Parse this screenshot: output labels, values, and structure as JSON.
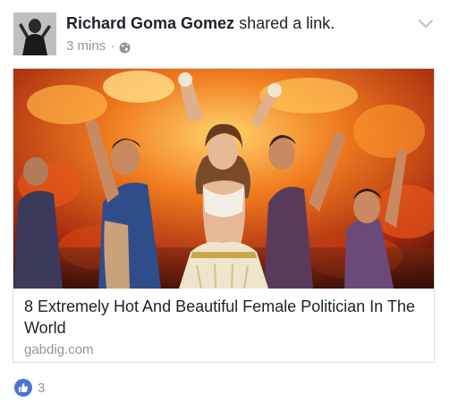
{
  "post": {
    "author": "Richard Goma Gomez",
    "action": "shared a link.",
    "timestamp": "3 mins",
    "separator": "·",
    "privacy_icon": "globe-icon",
    "menu_icon": "chevron-down-icon"
  },
  "link": {
    "title": "8 Extremely Hot And Beautiful Female Politician In The World",
    "domain": "gabdig.com",
    "image_icon": "link-preview-photo"
  },
  "reactions": {
    "icon": "like-icon",
    "count": "3",
    "accent_color": "#4a76d1"
  },
  "colors": {
    "text_primary": "#1d2129",
    "text_secondary": "#90949c",
    "border": "#dddfe2"
  }
}
